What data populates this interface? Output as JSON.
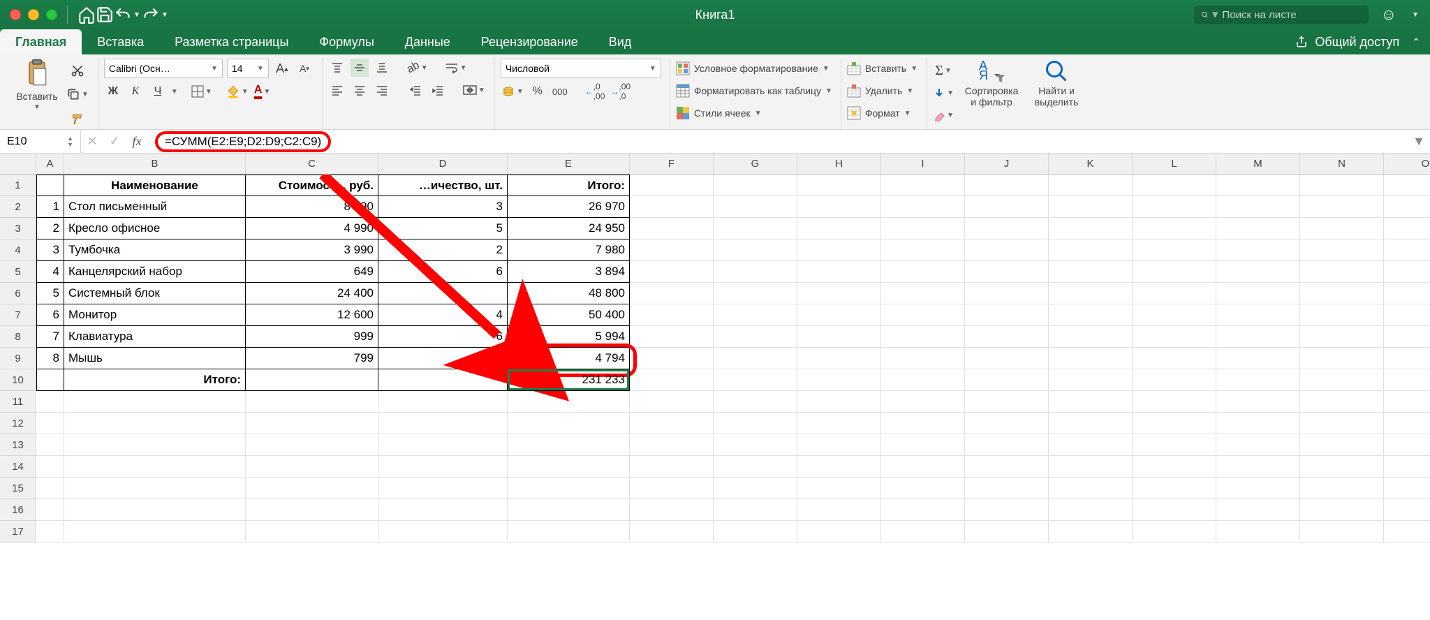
{
  "title": "Книга1",
  "search": {
    "placeholder": "Поиск на листе"
  },
  "tabs": {
    "items": [
      "Главная",
      "Вставка",
      "Разметка страницы",
      "Формулы",
      "Данные",
      "Рецензирование",
      "Вид"
    ],
    "active": 0,
    "share": "Общий доступ"
  },
  "ribbon": {
    "paste": "Вставить",
    "font_name": "Calibri (Осн…",
    "font_size": "14",
    "number_format": "Числовой",
    "cf": "Условное форматирование",
    "fat": "Форматировать как таблицу",
    "cs": "Стили ячеек",
    "ins": "Вставить",
    "del": "Удалить",
    "fmt": "Формат",
    "sort": "Сортировка\nи фильтр",
    "find": "Найти и\nвыделить"
  },
  "formula": {
    "cell": "E10",
    "value": "=СУММ(E2:E9;D2:D9;C2:C9)"
  },
  "cols": {
    "A": 40,
    "B": 260,
    "C": 190,
    "D": 185,
    "E": 175,
    "F": 120,
    "G": 120,
    "H": 120,
    "I": 120,
    "J": 120,
    "K": 120,
    "L": 120,
    "M": 120,
    "N": 120,
    "O": 120
  },
  "headers": {
    "B": "Наименование",
    "C": "Стоимость, руб.",
    "D": "…ичество, шт.",
    "E": "Итого:"
  },
  "data": [
    {
      "n": "1",
      "name": "Стол письменный",
      "cost": "8 990",
      "qty": "3",
      "total": "26 970"
    },
    {
      "n": "2",
      "name": "Кресло офисное",
      "cost": "4 990",
      "qty": "5",
      "total": "24 950"
    },
    {
      "n": "3",
      "name": "Тумбочка",
      "cost": "3 990",
      "qty": "2",
      "total": "7 980"
    },
    {
      "n": "4",
      "name": "Канцелярский набор",
      "cost": "649",
      "qty": "6",
      "total": "3 894"
    },
    {
      "n": "5",
      "name": "Системный блок",
      "cost": "24 400",
      "qty": "",
      "total": "48 800"
    },
    {
      "n": "6",
      "name": "Монитор",
      "cost": "12 600",
      "qty": "4",
      "total": "50 400"
    },
    {
      "n": "7",
      "name": "Клавиатура",
      "cost": "999",
      "qty": "6",
      "total": "5 994"
    },
    {
      "n": "8",
      "name": "Мышь",
      "cost": "799",
      "qty": "",
      "total": "4 794"
    }
  ],
  "footer": {
    "label": "Итого:",
    "total": "231 233"
  },
  "row_count": 17
}
